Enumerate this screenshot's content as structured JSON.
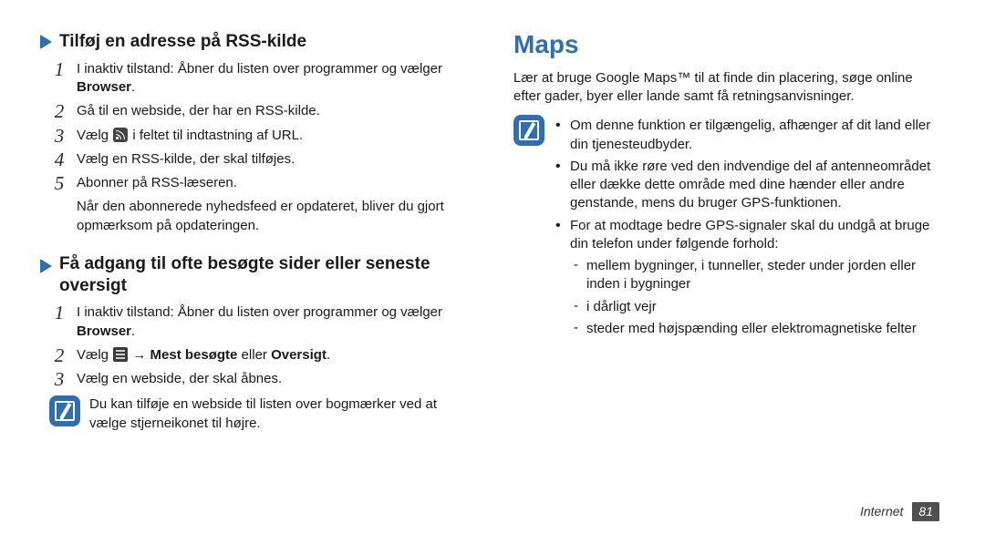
{
  "left": {
    "section1": {
      "title": "Tilføj en adresse på RSS-kilde",
      "steps": [
        {
          "pre": "I inaktiv tilstand: Åbner du listen over programmer og vælger ",
          "bold": "Browser",
          "post": "."
        },
        {
          "pre": "Gå til en webside, der har en RSS-kilde."
        },
        {
          "pre": "Vælg ",
          "icon": "rss",
          "post": " i feltet til indtastning af URL."
        },
        {
          "pre": "Vælg en RSS-kilde, der skal tilføjes."
        },
        {
          "pre": "Abonner på RSS-læseren."
        }
      ],
      "after": "Når den abonnerede nyhedsfeed er opdateret, bliver du gjort opmærksom på opdateringen."
    },
    "section2": {
      "title": "Få adgang til ofte besøgte sider eller seneste oversigt",
      "steps": [
        {
          "pre": "I inaktiv tilstand: Åbner du listen over programmer og vælger ",
          "bold": "Browser",
          "post": "."
        },
        {
          "pre": "Vælg ",
          "icon": "menu",
          "mid": " → ",
          "bold": "Mest besøgte",
          "mid2": " eller ",
          "bold2": "Oversigt",
          "post": "."
        },
        {
          "pre": "Vælg en webside, der skal åbnes."
        }
      ],
      "note": "Du kan tilføje en webside til listen over bogmærker ved at vælge stjerneikonet til højre."
    }
  },
  "right": {
    "title": "Maps",
    "intro": "Lær at bruge Google Maps™ til at finde din placering, søge online efter gader, byer eller lande samt få retningsanvisninger.",
    "bullets": [
      "Om denne funktion er tilgængelig, afhænger af dit land eller din tjenesteudbyder.",
      "Du må ikke røre ved den indvendige del af antenneområdet eller dække dette område med dine hænder eller andre genstande, mens du bruger GPS-funktionen.",
      "For at modtage bedre GPS-signaler skal du undgå at bruge din telefon under følgende forhold:"
    ],
    "dashes": [
      "mellem bygninger, i tunneller, steder under jorden eller inden i bygninger",
      "i dårligt vejr",
      "steder med højspænding eller elektromagnetiske felter"
    ]
  },
  "footer": {
    "section": "Internet",
    "page": "81"
  }
}
